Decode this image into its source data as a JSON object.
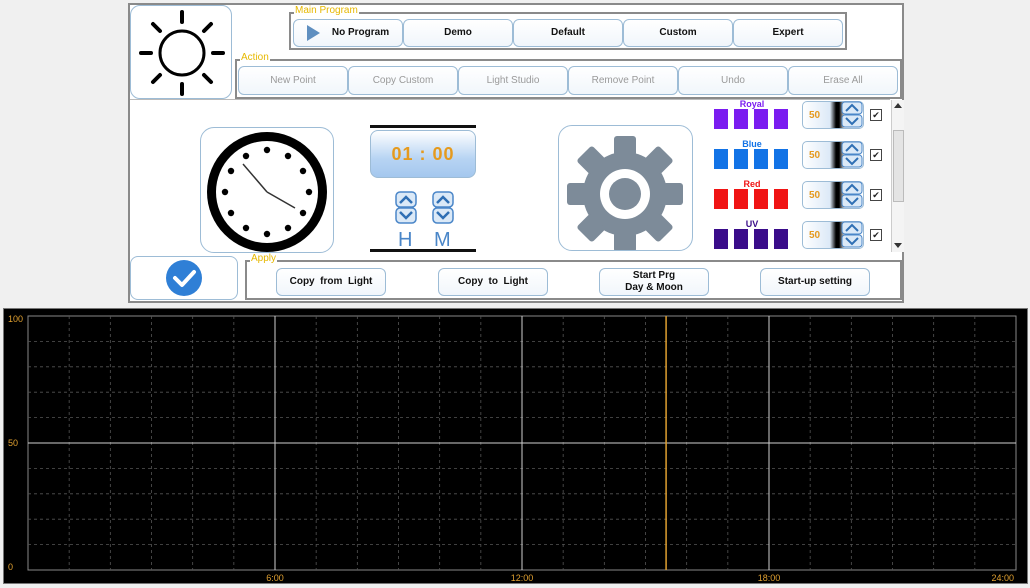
{
  "main_program": {
    "label": "Main Program",
    "buttons": [
      "No Program",
      "Demo",
      "Default",
      "Custom",
      "Expert"
    ]
  },
  "action": {
    "label": "Action",
    "buttons": [
      "New Point",
      "Copy Custom",
      "Light Studio",
      "Remove Point",
      "Undo",
      "Erase All"
    ]
  },
  "time": {
    "display": "01 : 00",
    "hour_label": "H",
    "minute_label": "M"
  },
  "channels": [
    {
      "name": "Royal",
      "value": "50",
      "color": "#7a1cf0",
      "checked": true
    },
    {
      "name": "Blue",
      "value": "50",
      "color": "#1273e6",
      "checked": true
    },
    {
      "name": "Red",
      "value": "50",
      "color": "#f01414",
      "checked": true
    },
    {
      "name": "UV",
      "value": "50",
      "color": "#3a0c8a",
      "checked": true
    }
  ],
  "apply": {
    "label": "Apply",
    "buttons": [
      "Copy  from  Light",
      "Copy  to  Light",
      "Start Prg\nDay & Moon",
      "Start-up setting"
    ]
  },
  "colors": {
    "accent_orange": "#e59a1e",
    "group_label": "#e6b800",
    "ok_blue": "#2f7fd6"
  },
  "chart_data": {
    "type": "line",
    "series": [],
    "x_tick_labels": [
      "6:00",
      "12:00",
      "18:00",
      "24:00"
    ],
    "y_tick_labels": [
      "0",
      "50",
      "100"
    ],
    "xlim": [
      0,
      24
    ],
    "ylim": [
      0,
      100
    ],
    "grid": true,
    "current_time_marker": 15.5
  }
}
